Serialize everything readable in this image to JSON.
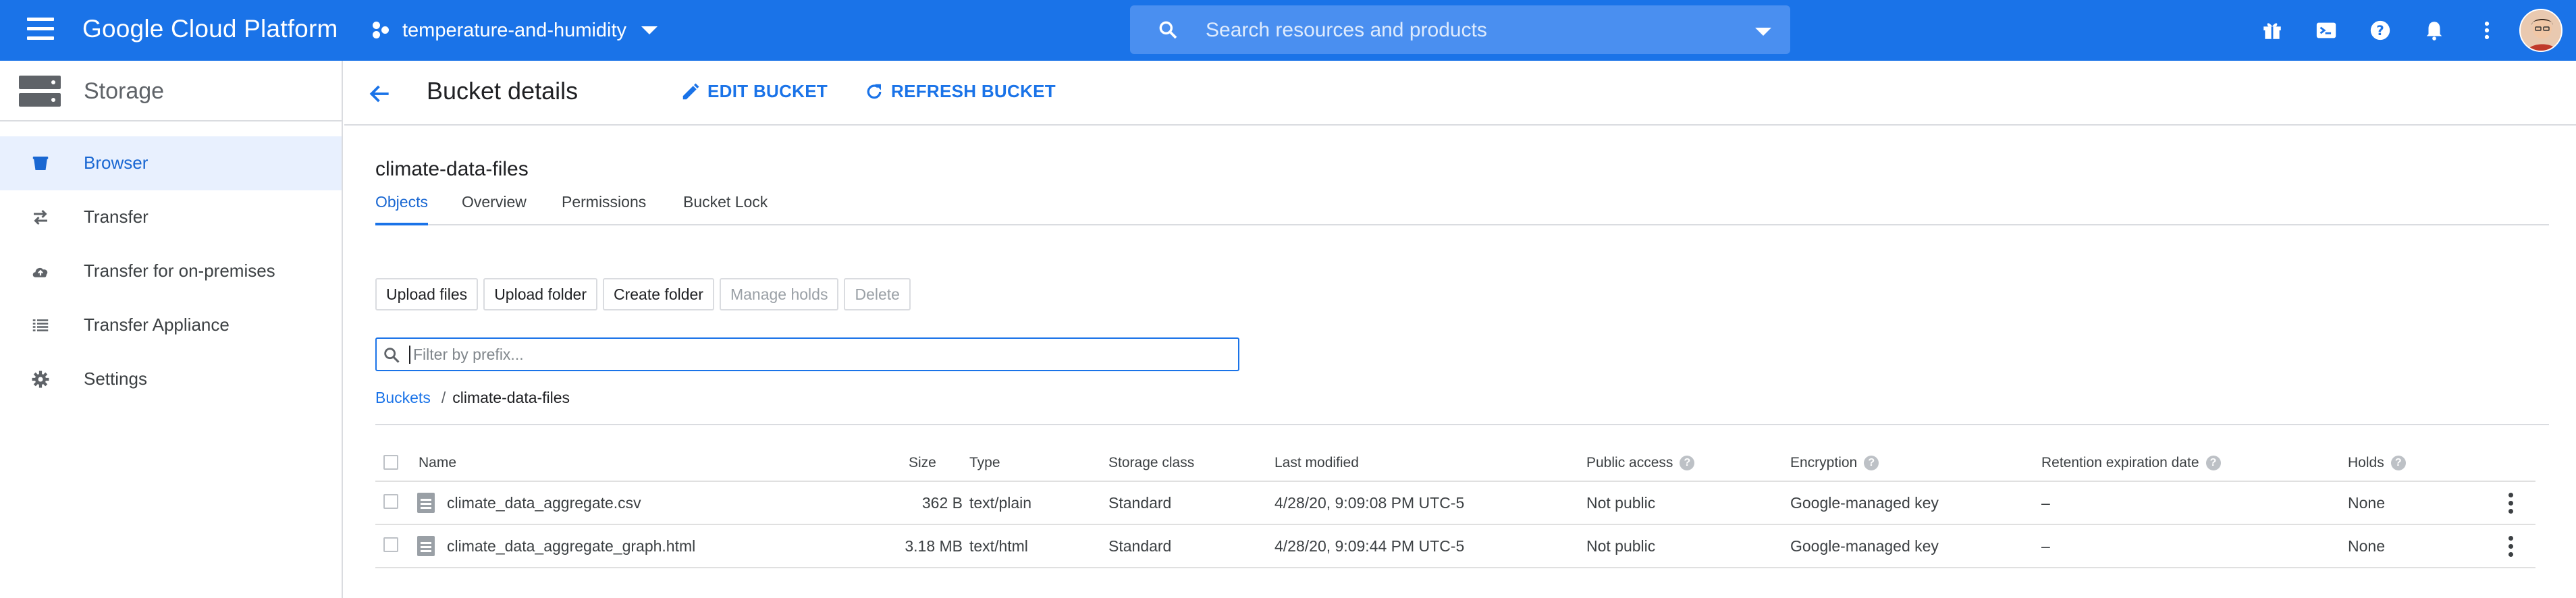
{
  "topbar": {
    "brand": "Google Cloud Platform",
    "project": "temperature-and-humidity",
    "search_placeholder": "Search resources and products",
    "icons": [
      "gift-icon",
      "cloud-shell-icon",
      "help-icon",
      "notifications-icon",
      "more-vert-icon"
    ],
    "color": "#1a73e8"
  },
  "sidebar": {
    "title": "Storage",
    "items": [
      {
        "label": "Browser",
        "icon": "bucket-icon",
        "active": true
      },
      {
        "label": "Transfer",
        "icon": "transfer-icon"
      },
      {
        "label": "Transfer for on-premises",
        "icon": "cloud-upload-icon"
      },
      {
        "label": "Transfer Appliance",
        "icon": "list-icon"
      },
      {
        "label": "Settings",
        "icon": "gear-icon"
      }
    ]
  },
  "header": {
    "title": "Bucket details",
    "edit_label": "EDIT BUCKET",
    "refresh_label": "REFRESH BUCKET"
  },
  "bucket": {
    "name": "climate-data-files",
    "tabs": [
      "Objects",
      "Overview",
      "Permissions",
      "Bucket Lock"
    ],
    "active_tab": "Objects"
  },
  "actions": {
    "upload_files": "Upload files",
    "upload_folder": "Upload folder",
    "create_folder": "Create folder",
    "manage_holds": "Manage holds",
    "delete": "Delete"
  },
  "filter": {
    "placeholder": "Filter by prefix..."
  },
  "breadcrumb": {
    "root": "Buckets",
    "separator": "/",
    "current": "climate-data-files"
  },
  "table": {
    "columns": {
      "name": "Name",
      "size": "Size",
      "type": "Type",
      "storage_class": "Storage class",
      "last_modified": "Last modified",
      "public_access": "Public access",
      "encryption": "Encryption",
      "retention": "Retention expiration date",
      "holds": "Holds"
    },
    "rows": [
      {
        "name": "climate_data_aggregate.csv",
        "size": "362 B",
        "type": "text/plain",
        "storage_class": "Standard",
        "last_modified": "4/28/20, 9:09:08 PM UTC-5",
        "public_access": "Not public",
        "encryption": "Google-managed key",
        "retention": "–",
        "holds": "None"
      },
      {
        "name": "climate_data_aggregate_graph.html",
        "size": "3.18 MB",
        "type": "text/html",
        "storage_class": "Standard",
        "last_modified": "4/28/20, 9:09:44 PM UTC-5",
        "public_access": "Not public",
        "encryption": "Google-managed key",
        "retention": "–",
        "holds": "None"
      }
    ]
  }
}
